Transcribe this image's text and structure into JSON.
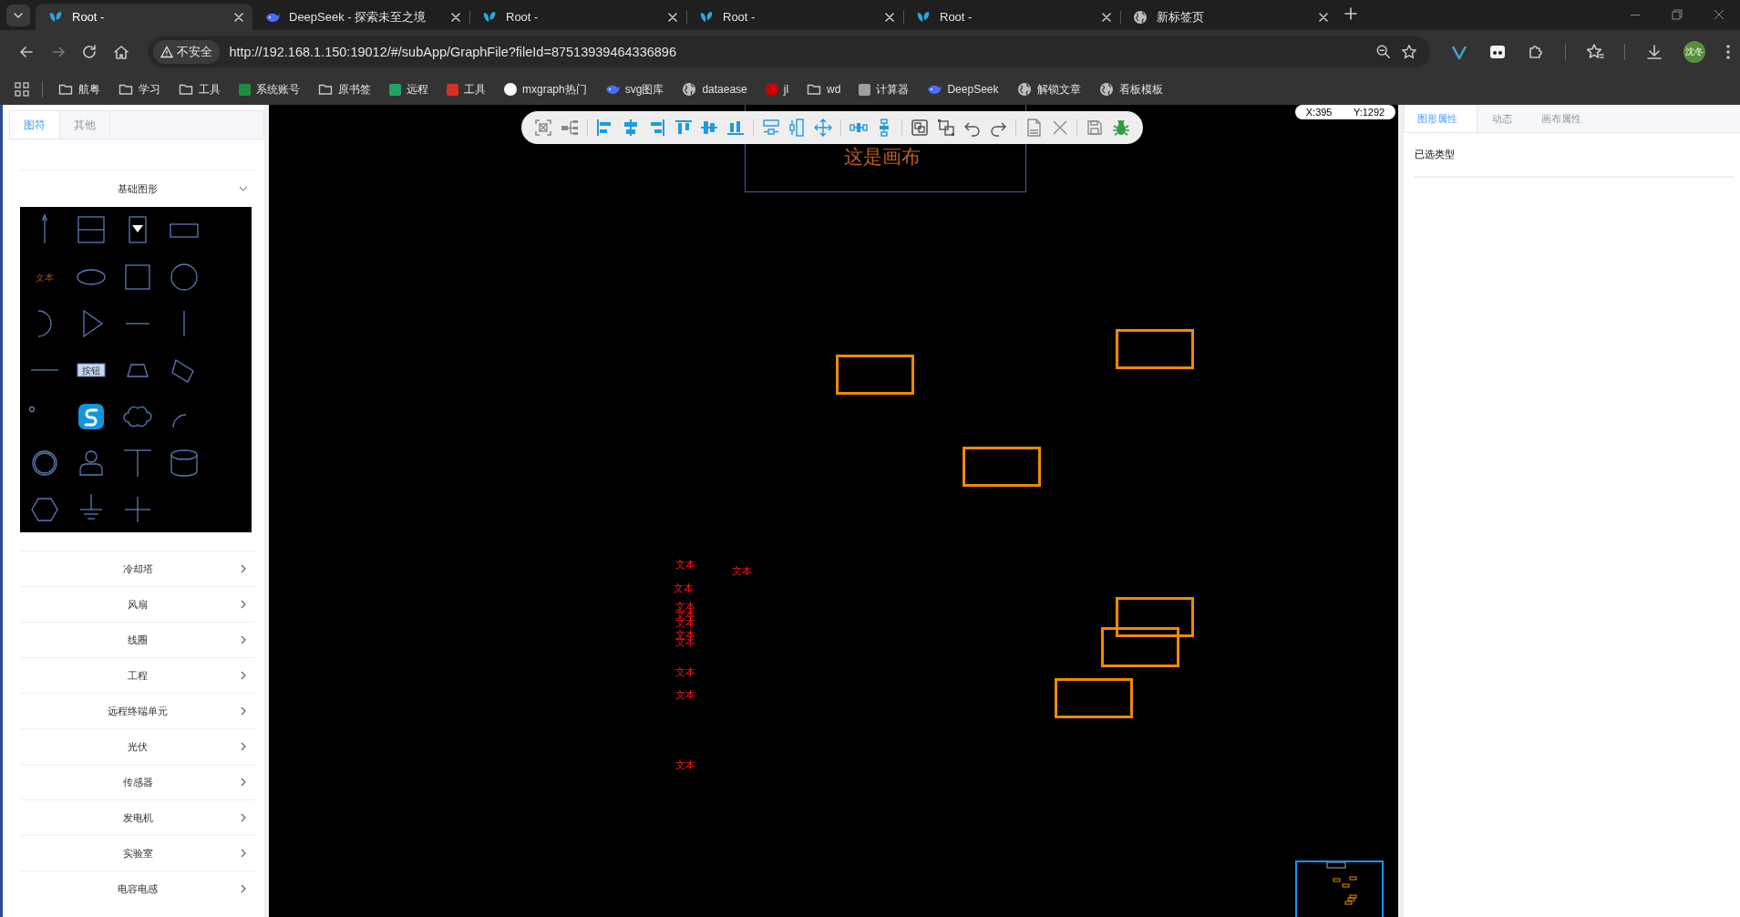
{
  "browser": {
    "tabs": [
      {
        "title": "Root -",
        "kind": "app",
        "selected": true
      },
      {
        "title": "DeepSeek - 探索未至之境",
        "kind": "whale",
        "selected": false
      },
      {
        "title": "Root -",
        "kind": "app",
        "selected": false
      },
      {
        "title": "Root -",
        "kind": "app",
        "selected": false
      },
      {
        "title": "Root -",
        "kind": "app",
        "selected": false
      },
      {
        "title": "新标签页",
        "kind": "globe",
        "selected": false
      }
    ],
    "security_label": "不安全",
    "url": "http://192.168.1.150:19012/#/subApp/GraphFile?fileId=87513939464336896",
    "bookmarks": [
      {
        "label": "航粤",
        "kind": "folder"
      },
      {
        "label": "学习",
        "kind": "folder"
      },
      {
        "label": "工具",
        "kind": "folder"
      },
      {
        "label": "系统账号",
        "kind": "tile",
        "color": "#1e8e3e"
      },
      {
        "label": "原书签",
        "kind": "folder"
      },
      {
        "label": "远程",
        "kind": "tile",
        "color": "#21a366"
      },
      {
        "label": "工具",
        "kind": "tile",
        "color": "#d93025"
      },
      {
        "label": "mxgraph热门",
        "kind": "badge",
        "color": "#ffffff"
      },
      {
        "label": "svg图库",
        "kind": "whale"
      },
      {
        "label": "dataease",
        "kind": "globe"
      },
      {
        "label": "jl",
        "kind": "badge",
        "color": "#d00000"
      },
      {
        "label": "wd",
        "kind": "folder"
      },
      {
        "label": "计算器",
        "kind": "tile",
        "color": "#9e9e9e"
      },
      {
        "label": "DeepSeek",
        "kind": "whale"
      },
      {
        "label": "解锁文章",
        "kind": "globe"
      },
      {
        "label": "看板模板",
        "kind": "globe"
      }
    ],
    "profile": "沈冬"
  },
  "left_panel": {
    "tabs": [
      {
        "label": "图符",
        "selected": true
      },
      {
        "label": "其他",
        "selected": false
      }
    ],
    "sections": [
      {
        "title": "基础图形",
        "expanded": true,
        "palette": {
          "text_sample": "文本",
          "button_label": "按钮"
        }
      },
      {
        "title": "冷却塔",
        "expanded": false
      },
      {
        "title": "风扇",
        "expanded": false
      },
      {
        "title": "线圈",
        "expanded": false
      },
      {
        "title": "工程",
        "expanded": false
      },
      {
        "title": "远程终端单元",
        "expanded": false
      },
      {
        "title": "光伏",
        "expanded": false
      },
      {
        "title": "传感器",
        "expanded": false
      },
      {
        "title": "发电机",
        "expanded": false
      },
      {
        "title": "实验室",
        "expanded": false
      },
      {
        "title": "电容电感",
        "expanded": false
      }
    ]
  },
  "canvas": {
    "frame_title": "这是画布",
    "cursor": {
      "x": "X:395",
      "y": "Y:1292"
    },
    "texts": [
      "文本",
      "文本",
      "文本",
      "文本",
      "文本",
      "文本",
      "文本",
      "文本",
      "文本",
      "文本",
      "文本"
    ],
    "shapes": [
      {
        "kind": "rect"
      },
      {
        "kind": "rect"
      },
      {
        "kind": "rect"
      },
      {
        "kind": "rect"
      },
      {
        "kind": "rect"
      },
      {
        "kind": "rect"
      }
    ]
  },
  "right_panel": {
    "tabs": [
      {
        "label": "图形属性",
        "selected": true
      },
      {
        "label": "动态",
        "selected": false
      },
      {
        "label": "画布属性",
        "selected": false
      }
    ],
    "fields": [
      {
        "label": "已选类型"
      }
    ]
  }
}
